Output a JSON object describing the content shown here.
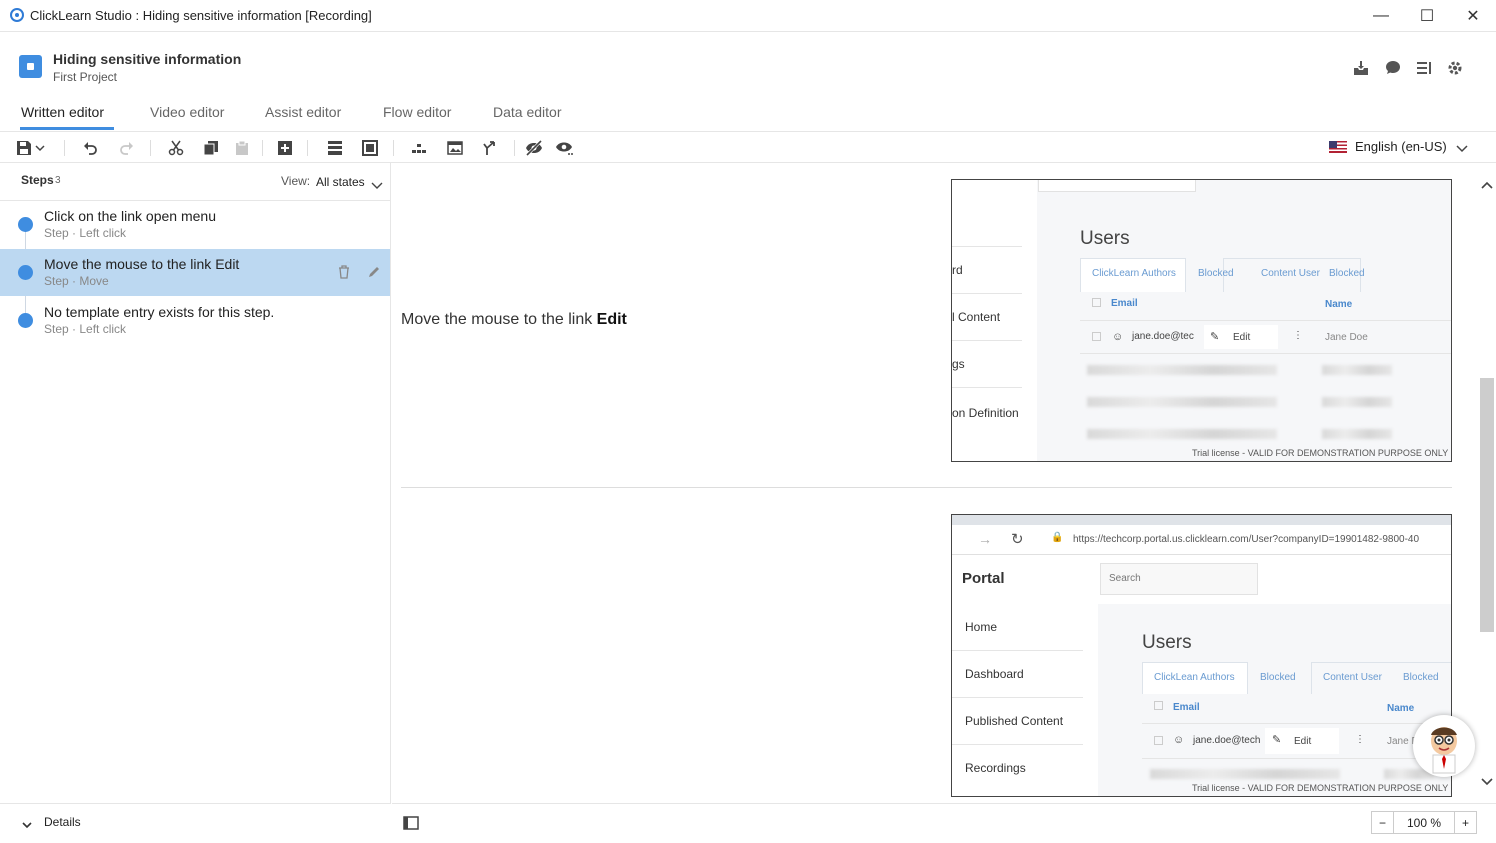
{
  "window": {
    "title": "ClickLearn Studio : Hiding sensitive information [Recording]",
    "minimize": "—",
    "maximize": "☐",
    "close": "✕"
  },
  "project": {
    "title": "Hiding sensitive information",
    "subtitle": "First Project"
  },
  "header_icons": [
    "inbox-download-icon",
    "chat-icon",
    "list-icon",
    "gear-icon"
  ],
  "tabs": [
    {
      "label": "Written editor",
      "active": true
    },
    {
      "label": "Video editor",
      "active": false
    },
    {
      "label": "Assist editor",
      "active": false
    },
    {
      "label": "Flow editor",
      "active": false
    },
    {
      "label": "Data editor",
      "active": false
    }
  ],
  "toolbar": {
    "language": "English (en-US)"
  },
  "steps_panel": {
    "label": "Steps",
    "count": "3",
    "view_label": "View:",
    "view_value": "All states",
    "steps": [
      {
        "title": "Click on the link open menu",
        "subtitle": "Step · Left click",
        "selected": false
      },
      {
        "title": "Move the mouse to the link Edit",
        "subtitle": "Step · Move",
        "selected": true
      },
      {
        "title": "No template entry exists for this step.",
        "subtitle": "Step · Left click",
        "selected": false
      }
    ],
    "details_label": "Details"
  },
  "content": {
    "step_text_prefix": "Move the mouse to the link ",
    "step_text_bold": "Edit",
    "screenshot1": {
      "nav_items": [
        "rd",
        "l Content",
        "gs",
        "on Definition"
      ],
      "page_title": "Users",
      "tabs": [
        "ClickLearn Authors",
        "Blocked",
        "Content User",
        "Blocked"
      ],
      "col_email": "Email",
      "col_name": "Name",
      "row_email": "jane.doe@tec",
      "row_action": "Edit",
      "row_name": "Jane Doe",
      "trial": "Trial license - VALID FOR DEMONSTRATION PURPOSE ONLY"
    },
    "screenshot2": {
      "url": "https://techcorp.portal.us.clicklearn.com/User?companyID=19901482-9800-40",
      "brand": "Portal",
      "search_placeholder": "Search",
      "nav_items": [
        "Home",
        "Dashboard",
        "Published Content",
        "Recordings"
      ],
      "page_title": "Users",
      "tabs": [
        "ClickLean Authors",
        "Blocked",
        "Content User",
        "Blocked"
      ],
      "col_email": "Email",
      "col_name": "Name",
      "row_email": "jane.doe@tech",
      "row_action": "Edit",
      "row_name": "Jane D",
      "trial": "Trial license - VALID FOR DEMONSTRATION PURPOSE ONLY"
    }
  },
  "zoom": {
    "minus": "−",
    "value": "100 %",
    "plus": "+"
  }
}
